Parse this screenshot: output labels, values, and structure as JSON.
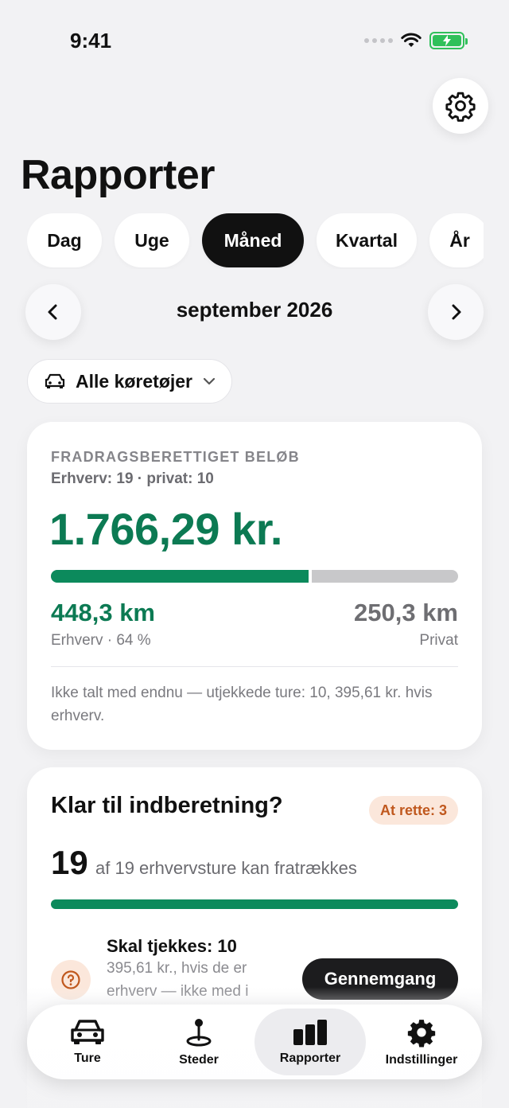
{
  "status_bar": {
    "time": "9:41"
  },
  "header": {
    "title": "Rapporter",
    "settings_icon": "gear-icon"
  },
  "period_tabs": [
    {
      "label": "Dag",
      "active": false
    },
    {
      "label": "Uge",
      "active": false
    },
    {
      "label": "Måned",
      "active": true
    },
    {
      "label": "Kvartal",
      "active": false
    },
    {
      "label": "År",
      "active": false
    }
  ],
  "period_nav": {
    "label": "september 2026",
    "prev_icon": "chevron-left-icon",
    "next_icon": "chevron-right-icon"
  },
  "vehicle_filter": {
    "label": "Alle køretøjer",
    "icon": "car-icon"
  },
  "deductible_card": {
    "eyebrow": "FRADRAGSBERETTIGET BELØB",
    "subtitle": "Erhverv: 19 · privat: 10",
    "amount": "1.766,29 kr.",
    "business_share": 0.64,
    "business_km": "448,3 km",
    "business_label": "Erhverv · 64 %",
    "private_km": "250,3 km",
    "private_label": "Privat",
    "note": "Ikke talt med endnu — utjekkede ture: 10, 395,61 kr. hvis erhverv."
  },
  "ready_card": {
    "title": "Klar til indberetning?",
    "badge": "At rette: 3",
    "count": "19",
    "count_desc": "af 19 erhvervsture kan fratrækkes",
    "progress": 1.0,
    "check_title": "Skal tjekkes: 10",
    "check_desc": "395,61 kr., hvis de er erhverv — ikke med i",
    "review_button": "Gennemgang"
  },
  "tab_bar": [
    {
      "label": "Ture",
      "icon": "car-icon",
      "active": false
    },
    {
      "label": "Steder",
      "icon": "location-pin-icon",
      "active": false
    },
    {
      "label": "Rapporter",
      "icon": "bar-chart-icon",
      "active": true
    },
    {
      "label": "Indstillinger",
      "icon": "gear-icon",
      "active": false
    }
  ],
  "colors": {
    "accent_green": "#0c7a53",
    "warning_orange": "#c0581e",
    "background": "#f2f2f4"
  }
}
